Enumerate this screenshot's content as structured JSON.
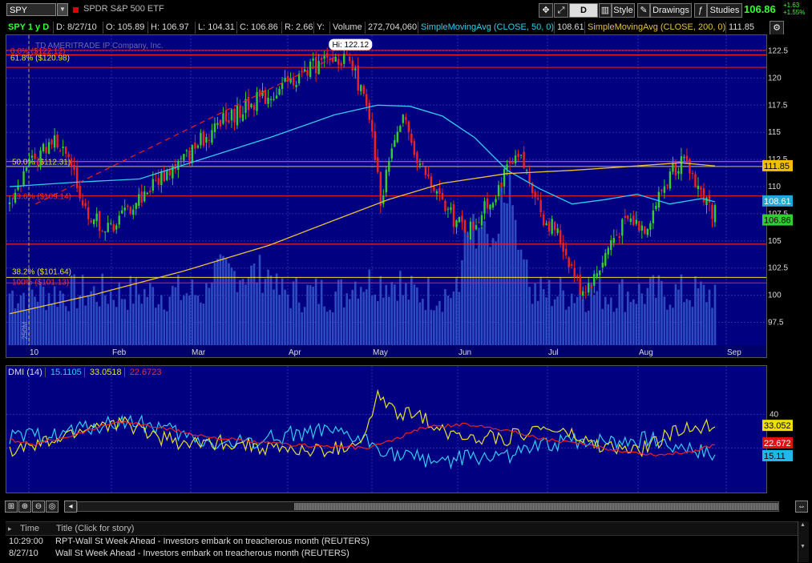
{
  "toolbar": {
    "symbol": "SPY",
    "security_name": "SPDR S&P 500 ETF",
    "period_button": "D",
    "style_label": "Style",
    "drawings_label": "Drawings",
    "studies_label": "Studies",
    "last_price": "106.86",
    "change": "+1.63",
    "change_pct": "+1.55%"
  },
  "header": {
    "title": "SPY 1 y D",
    "date": "D: 8/27/10",
    "open": "O: 105.89",
    "high": "H: 106.97",
    "low": "L: 104.31",
    "close": "C: 106.86",
    "range": "R: 2.66",
    "y": "Y:",
    "volume_label": "Volume",
    "volume": "272,704,060",
    "sma50_label": "SimpleMovingAvg (CLOSE, 50, 0)",
    "sma50_value": "108.61",
    "sma200_label": "SimpleMovingAvg (CLOSE, 200, 0)",
    "sma200_value": "111.85"
  },
  "price_chart": {
    "watermark": "TD AMERITRADE IP Company, Inc.",
    "hi_label": "Hi: 122.12",
    "y_ticks": [
      "122.5",
      "120",
      "117.5",
      "115",
      "112.5",
      "110",
      "107.5",
      "105",
      "102.5",
      "100",
      "97.5"
    ],
    "x_ticks": [
      "10",
      "Feb",
      "Mar",
      "Apr",
      "May",
      "Jun",
      "Jul",
      "Aug",
      "Sep"
    ],
    "fib_labels": [
      "61.8% ($120.98)",
      "0.0% ($122.12)",
      "50.0% ($112.31)",
      "23.6% ($109.14)",
      "38.2% ($101.64)",
      "100% ($101.13)"
    ],
    "vol_axis_label": "250M",
    "badge_sma200": "111.85",
    "badge_sma50": "108.61",
    "badge_last": "106.86"
  },
  "dmi": {
    "label": "DMI (14)",
    "v1": "15.1105",
    "v2": "33.0518",
    "v3": "22.6723",
    "tick_40": "40",
    "badge_yellow": "33.052",
    "badge_red": "22.672",
    "badge_cyan": "15.11"
  },
  "news": {
    "col_time": "Time",
    "col_title": "Title (Click for story)",
    "rows": [
      {
        "time": "10:29:00",
        "title": "RPT-Wall St Week Ahead - Investors embark on treacherous month (REUTERS)"
      },
      {
        "time": "8/27/10",
        "title": "Wall St Week Ahead - Investors embark on treacherous month (REUTERS)"
      }
    ]
  },
  "colors": {
    "bg": "#000080",
    "grid": "#2b2bb0",
    "up": "#33cc33",
    "down": "#ee2222",
    "sma50": "#33ccee",
    "sma200": "#e8c040",
    "volume": "#2e4bc2",
    "fib_magenta": "#dd44dd"
  }
}
